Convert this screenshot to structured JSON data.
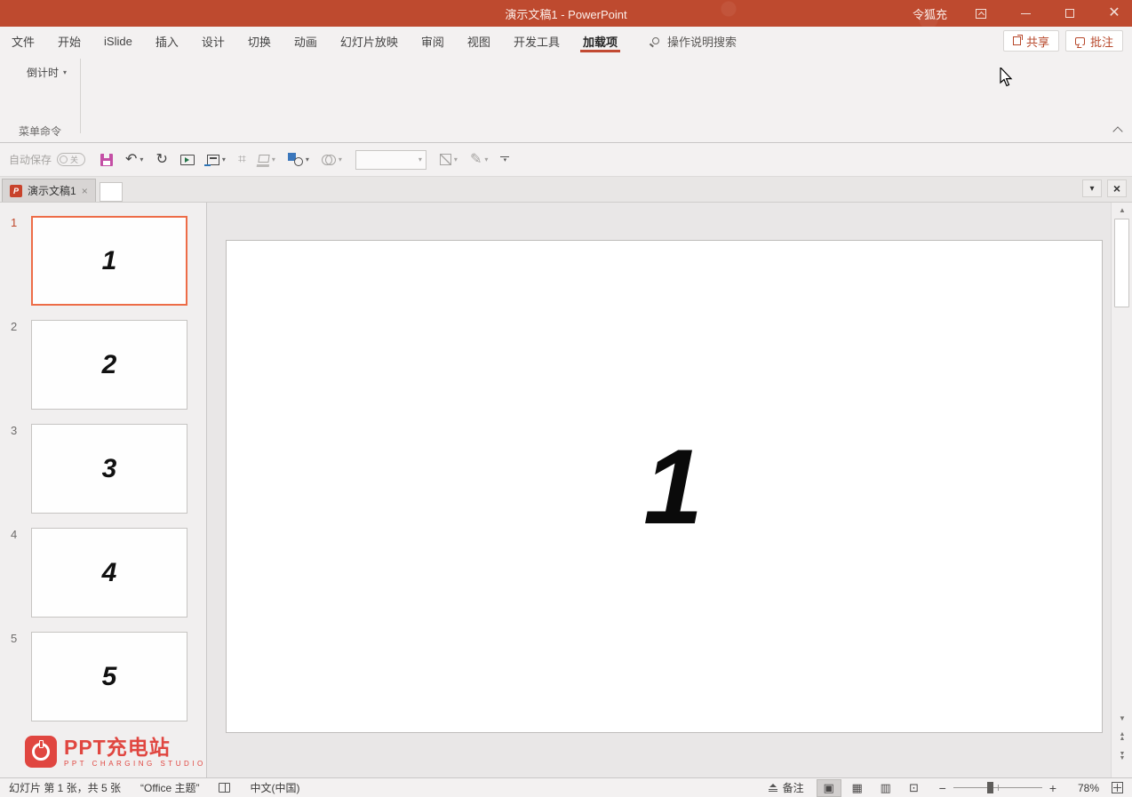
{
  "titlebar": {
    "title": "演示文稿1 - PowerPoint",
    "user": "令狐充"
  },
  "ribbon": {
    "tabs": [
      "文件",
      "开始",
      "iSlide",
      "插入",
      "设计",
      "切换",
      "动画",
      "幻灯片放映",
      "审阅",
      "视图",
      "开发工具",
      "加载项"
    ],
    "active_tab": "加载项",
    "search_label": "操作说明搜索",
    "share_label": "共享",
    "comment_label": "批注",
    "addin_button_label": "倒计时",
    "group_label": "菜单命令",
    "accent_color": "#C24A33"
  },
  "qat": {
    "autosave_label": "自动保存",
    "autosave_state": "关",
    "icons": {
      "undo": "↶",
      "redo": "↻",
      "crop": "⌗",
      "caret": "▾",
      "pen": "✎"
    }
  },
  "doctabs": {
    "active_title": "演示文稿1",
    "icon_letter": "P",
    "close_glyph": "×",
    "menu_caret": "▾"
  },
  "slides": [
    {
      "index": "1",
      "content": "1",
      "selected": true
    },
    {
      "index": "2",
      "content": "2",
      "selected": false
    },
    {
      "index": "3",
      "content": "3",
      "selected": false
    },
    {
      "index": "4",
      "content": "4",
      "selected": false
    },
    {
      "index": "5",
      "content": "5",
      "selected": false
    }
  ],
  "canvas": {
    "number": "1"
  },
  "logo": {
    "title": "PPT充电站",
    "subtitle": "PPT CHARGING STUDIO",
    "color": "#E04640"
  },
  "scrollbar": {
    "up": "▲",
    "down": "▼"
  },
  "statusbar": {
    "slide_info": "幻灯片 第 1 张，共 5 张",
    "theme": "“Office 主题”",
    "language": "中文(中国)",
    "notes_label": "备注",
    "view_icons": {
      "normal": "▣",
      "sorter": "▦",
      "reading": "▥",
      "slideshow": "⊡"
    },
    "zoom_minus": "−",
    "zoom_plus": "+",
    "zoom_value": "78%"
  },
  "colors": {
    "titlebar": "#BE4A2F",
    "selected_thumb_border": "#ED6C47",
    "ribbon_bg": "#F3F1F1",
    "save_icon": "#C44FA5"
  }
}
